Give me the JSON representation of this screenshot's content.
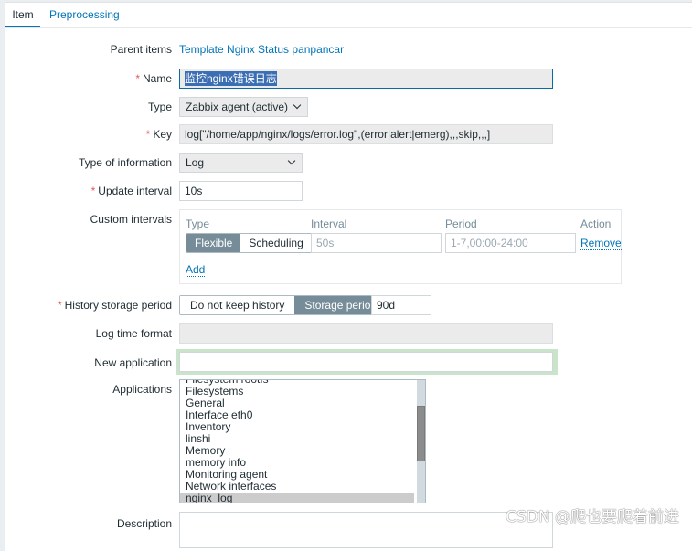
{
  "tabs": [
    {
      "label": "Item",
      "active": true
    },
    {
      "label": "Preprocessing",
      "active": false
    }
  ],
  "form": {
    "parent_items": {
      "label": "Parent items",
      "value": "Template Nginx Status panpancar"
    },
    "name": {
      "label": "Name",
      "required": "*",
      "value": "监控nginx错误日志"
    },
    "type": {
      "label": "Type",
      "value": "Zabbix agent (active)"
    },
    "key": {
      "label": "Key",
      "required": "*",
      "value": "log[\"/home/app/nginx/logs/error.log\",(error|alert|emerg),,,skip,,,]"
    },
    "type_of_information": {
      "label": "Type of information",
      "value": "Log"
    },
    "update_interval": {
      "label": "Update interval",
      "required": "*",
      "value": "10s"
    },
    "custom_intervals": {
      "label": "Custom intervals",
      "headers": {
        "type": "Type",
        "interval": "Interval",
        "period": "Period",
        "action": "Action"
      },
      "rows": [
        {
          "type_options": [
            "Flexible",
            "Scheduling"
          ],
          "type_selected": "Flexible",
          "interval_placeholder": "50s",
          "period_placeholder": "1-7,00:00-24:00",
          "action": "Remove"
        }
      ],
      "add_label": "Add"
    },
    "history_storage": {
      "label": "History storage period",
      "required": "*",
      "options": [
        "Do not keep history",
        "Storage period"
      ],
      "selected": "Storage period",
      "value": "90d"
    },
    "log_time_format": {
      "label": "Log time format",
      "value": ""
    },
    "new_application": {
      "label": "New application",
      "value": ""
    },
    "applications": {
      "label": "Applications",
      "items": [
        "Filesystem rootfs",
        "Filesystems",
        "General",
        "Interface eth0",
        "Inventory",
        "linshi",
        "Memory",
        "memory info",
        "Monitoring agent",
        "Network interfaces",
        "nginx_log"
      ],
      "selected": "nginx_log"
    },
    "description": {
      "label": "Description",
      "value": ""
    }
  },
  "watermark": "CSDN @爬也要爬着前进"
}
